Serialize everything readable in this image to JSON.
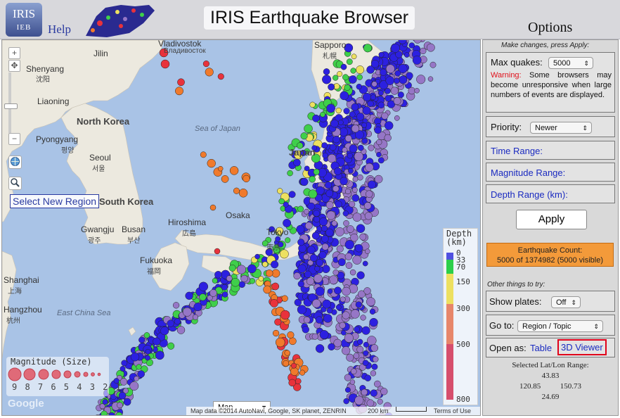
{
  "header": {
    "logo_top": "IRIS",
    "logo_bottom": "IEB",
    "help_label": "Help",
    "app_title": "IRIS Earthquake Browser",
    "options_title": "Options"
  },
  "map": {
    "controls": {
      "zoom_in": "+",
      "zoom_out": "−",
      "pan": "✥"
    },
    "select_region_label": "Select New Region",
    "map_type": "Map",
    "google_logo": "Google",
    "attribution": "Map data ©2014 AutoNavi, Google, SK planet, ZENRIN",
    "scale_label": "200 km",
    "terms_label": "Terms of Use",
    "labels": {
      "jilin": "Jilin",
      "shenyang": "Shenyang",
      "shenyang_cn": "沈阳",
      "liaoning": "Liaoning",
      "north_korea": "North Korea",
      "pyongyang": "Pyongyang",
      "pyongyang_kr": "평양",
      "seoul": "Seoul",
      "seoul_kr": "서울",
      "south_korea": "South Korea",
      "gwangju": "Gwangju",
      "gwangju_kr": "광주",
      "busan": "Busan",
      "busan_kr": "부산",
      "vladivostok": "Vladivostok",
      "vladivostok_ru": "Владивосток",
      "sapporo": "Sapporo",
      "sapporo_jp": "札幌",
      "sea_of_japan": "Sea of Japan",
      "japan": "Japan",
      "hiroshima": "Hiroshima",
      "hiroshima_jp": "広島",
      "osaka": "Osaka",
      "tokyo": "Tokyo",
      "tokyo_jp": "東京",
      "fukuoka": "Fukuoka",
      "fukuoka_jp": "福岡",
      "shanghai": "Shanghai",
      "shanghai_cn": "上海",
      "hangzhou": "Hangzhou",
      "hangzhou_cn": "杭州",
      "east_china_sea": "East China Sea"
    },
    "magnitude_legend": {
      "title": "Magnitude (Size)",
      "scale": "9 8 7 6 5 4 3 2 1"
    },
    "depth_legend": {
      "title_line1": "Depth",
      "title_line2": "(km)",
      "ticks": [
        "0",
        "33",
        "70",
        "150",
        "300",
        "500",
        "800"
      ]
    }
  },
  "panel": {
    "intro": "Make changes, press Apply:",
    "max_quakes_label": "Max quakes:",
    "max_quakes_value": "5000",
    "warning_label": "Warning:",
    "warning_text": "Some browsers may become unresponsive when large numbers of events are displayed.",
    "priority_label": "Priority:",
    "priority_value": "Newer",
    "time_range_label": "Time Range:",
    "magnitude_range_label": "Magnitude Range:",
    "depth_range_label": "Depth Range (km):",
    "apply_label": "Apply",
    "count_title": "Earthquake Count:",
    "count_value": "5000 of 1374982 (5000 visible)",
    "other_things": "Other things to try:",
    "show_plates_label": "Show plates:",
    "show_plates_value": "Off",
    "goto_label": "Go to:",
    "goto_value": "Region / Topic",
    "open_as_label": "Open as:",
    "table_link": "Table",
    "viewer_link": "3D Viewer",
    "latlon_title": "Selected Lat/Lon Range:",
    "lat_max": "43.83",
    "lon_min": "120.85",
    "lon_max": "150.73",
    "lat_min": "24.69"
  },
  "colors": {
    "depth_0_33": "#e8323c",
    "depth_33_70": "#f07a2c",
    "depth_70_150": "#ede060",
    "depth_150_300": "#3fcf4a",
    "depth_300_500": "#2c20e0",
    "depth_500_800": "#9676c6",
    "land": "#ece9df",
    "water": "#a9c3e6",
    "link": "#1a2ac0",
    "count_box": "#f39a3a",
    "viewer_border": "#e0001a"
  }
}
